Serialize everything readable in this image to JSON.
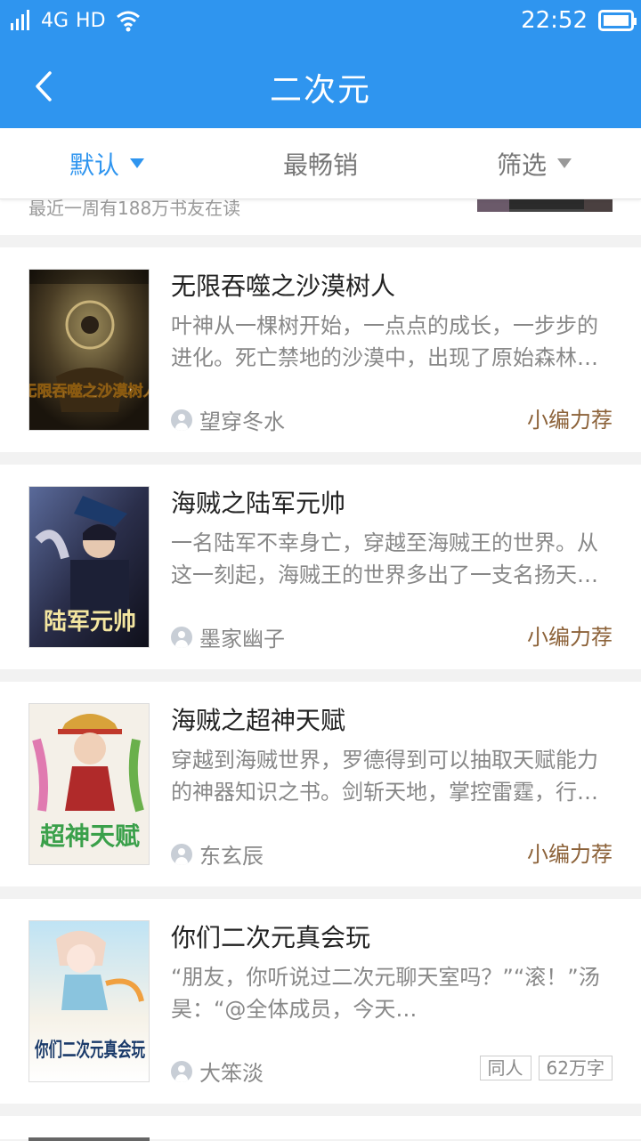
{
  "status_bar": {
    "network": "4G",
    "hd": "HD",
    "time": "22:52"
  },
  "nav": {
    "title": "二次元"
  },
  "sort_tabs": [
    {
      "label": "默认",
      "active": true
    },
    {
      "label": "最畅销",
      "active": false
    },
    {
      "label": "筛选",
      "active": false
    }
  ],
  "partial_item": {
    "text": "最近一周有188万书友在读"
  },
  "books": [
    {
      "title": "无限吞噬之沙漠树人",
      "description": "叶神从一棵树开始，一点点的成长，一步步的进化。死亡禁地的沙漠中，出现了原始森林…",
      "author": "望穿冬水",
      "badge": "小编力荐",
      "cover_text": "无限吞噬之沙漠树人"
    },
    {
      "title": "海贼之陆军元帅",
      "description": "一名陆军不幸身亡，穿越至海贼王的世界。从这一刻起，海贼王的世界多出了一支名扬天…",
      "author": "墨家幽子",
      "badge": "小编力荐",
      "cover_text": "陆军元帅"
    },
    {
      "title": "海贼之超神天赋",
      "description": "穿越到海贼世界，罗德得到可以抽取天赋能力的神器知识之书。剑斩天地，掌控雷霆，行…",
      "author": "东玄辰",
      "badge": "小编力荐",
      "cover_text": "超神天赋"
    },
    {
      "title": "你们二次元真会玩",
      "description": "“朋友，你听说过二次元聊天室吗？”“滚！”汤昊：“@全体成员，今天…",
      "author": "大笨淡",
      "tags": [
        "同人",
        "62万字"
      ],
      "cover_text": "你们二次元真会玩"
    }
  ],
  "colors": {
    "primary": "#2f95ef",
    "badge": "#8c6239",
    "background": "#f2f2f2"
  }
}
